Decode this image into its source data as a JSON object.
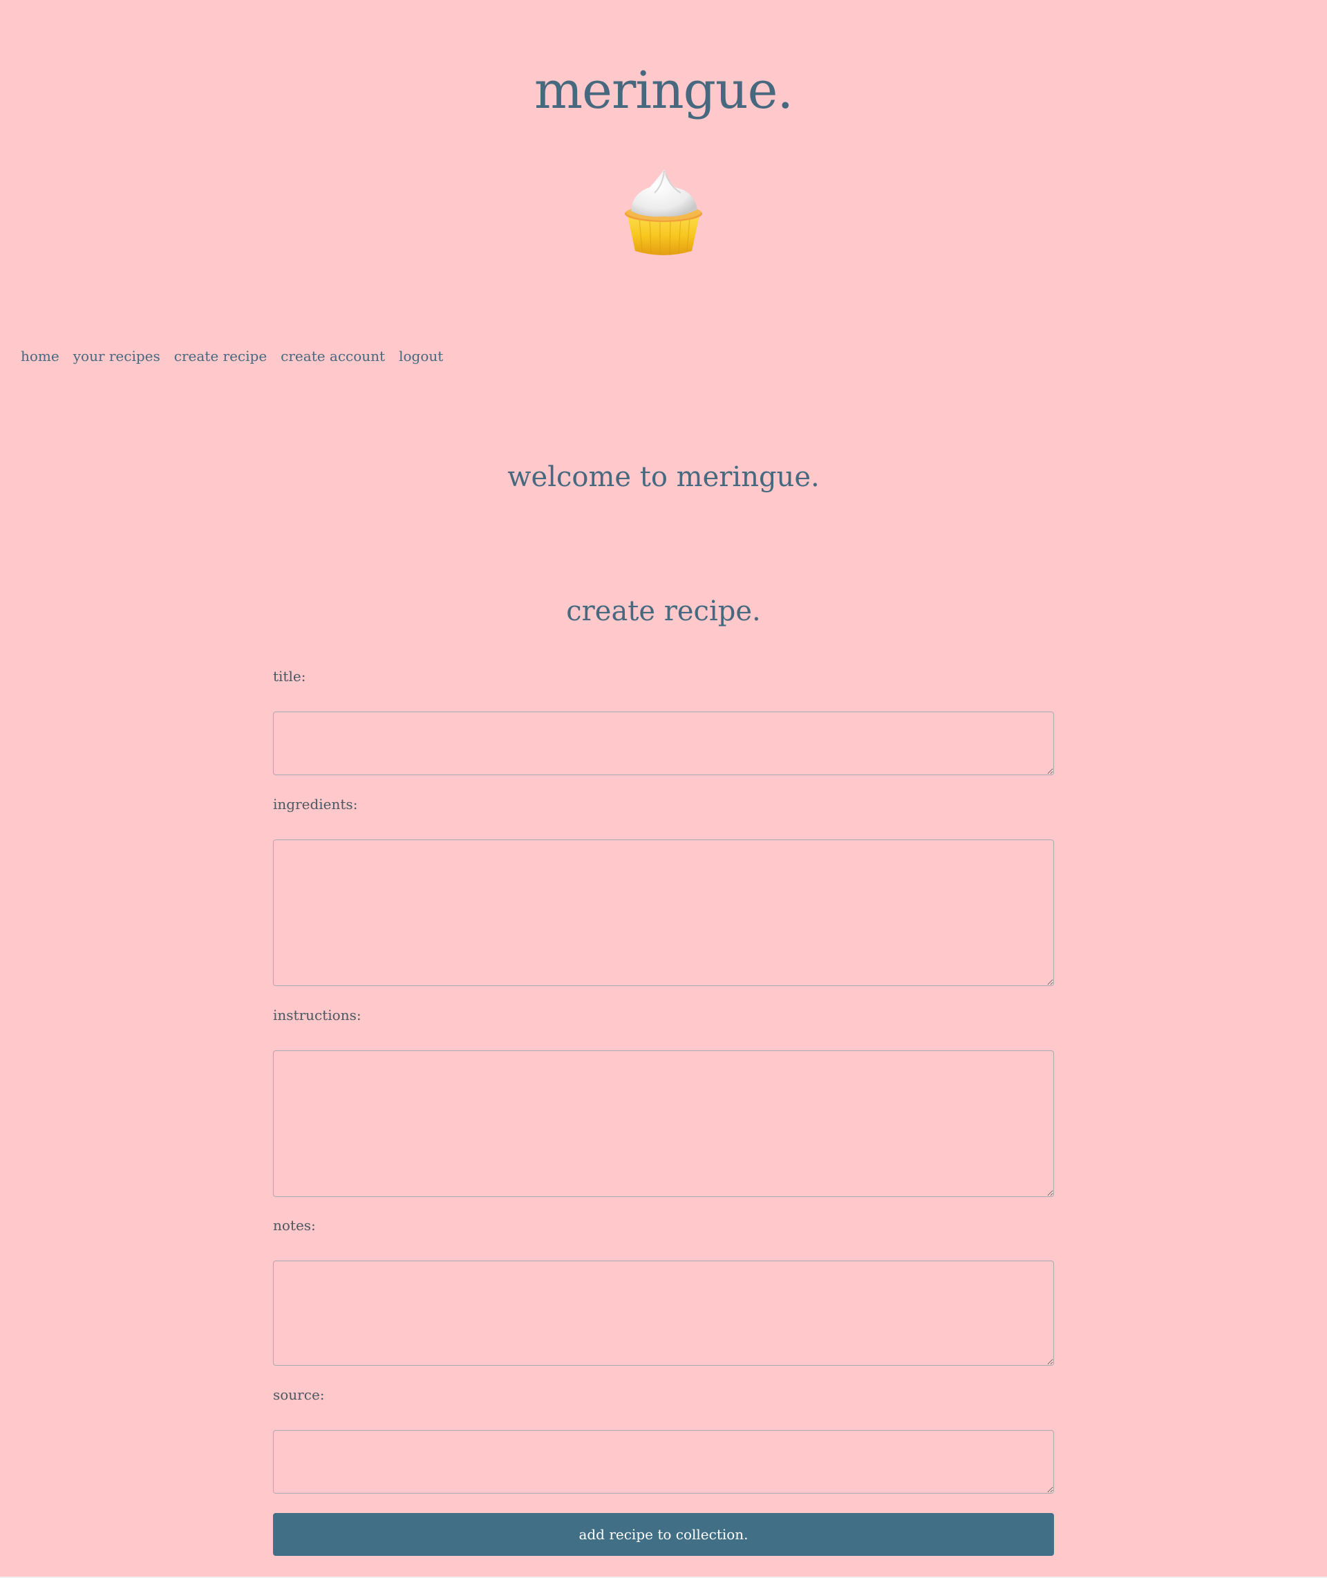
{
  "site": {
    "title": "meringue.",
    "logo_icon": "lemon-meringue-tart-icon"
  },
  "nav": {
    "items": [
      {
        "label": "home"
      },
      {
        "label": "your recipes"
      },
      {
        "label": "create recipe"
      },
      {
        "label": "create account"
      },
      {
        "label": "logout"
      }
    ]
  },
  "welcome": "welcome to meringue.",
  "form": {
    "title": "create recipe.",
    "fields": {
      "title": {
        "label": "title:",
        "value": ""
      },
      "ingredients": {
        "label": "ingredients:",
        "value": ""
      },
      "instructions": {
        "label": "instructions:",
        "value": ""
      },
      "notes": {
        "label": "notes:",
        "value": ""
      },
      "source": {
        "label": "source:",
        "value": ""
      }
    },
    "submit_label": "add recipe to collection."
  },
  "colors": {
    "background": "#ffc8ca",
    "text": "#46697f",
    "button": "#416f86",
    "field_border": "#a9aab1"
  }
}
